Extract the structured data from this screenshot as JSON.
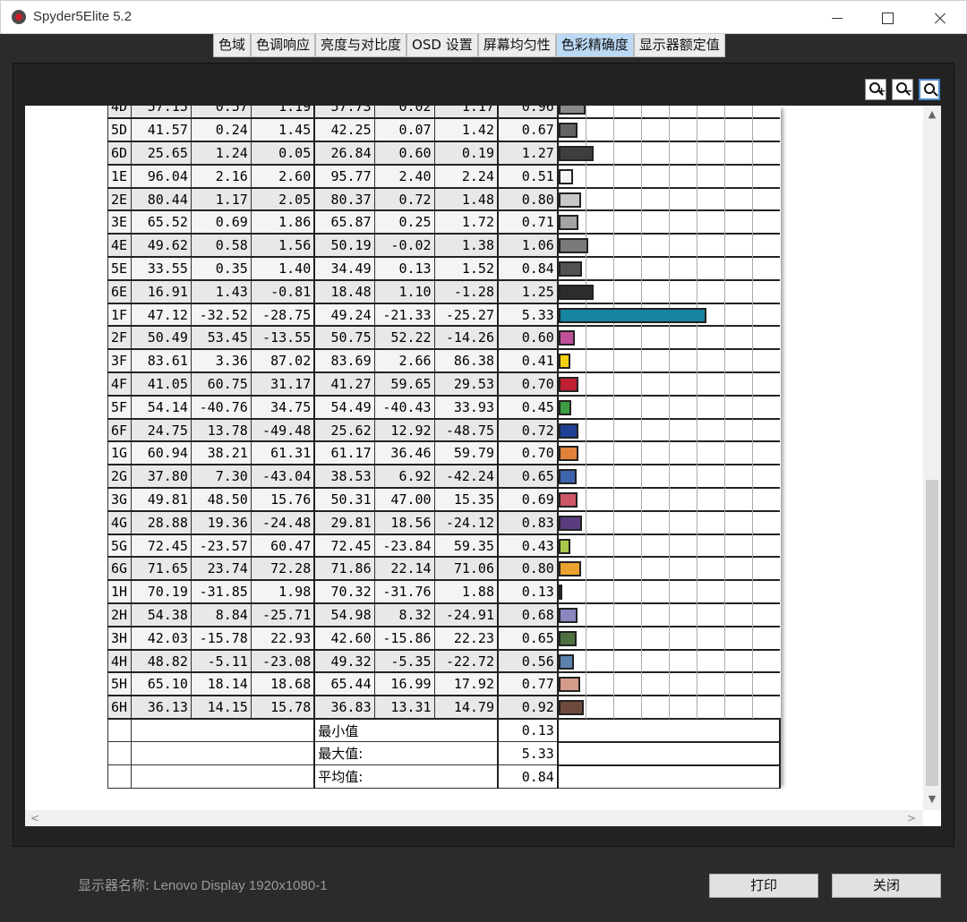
{
  "window": {
    "title": "Spyder5Elite 5.2"
  },
  "tabs": [
    {
      "label": "色域",
      "active": false
    },
    {
      "label": "色调响应",
      "active": false
    },
    {
      "label": "亮度与对比度",
      "active": false
    },
    {
      "label": "OSD 设置",
      "active": false
    },
    {
      "label": "屏幕均匀性",
      "active": false
    },
    {
      "label": "色彩精确度",
      "active": true
    },
    {
      "label": "显示器额定值",
      "active": false
    }
  ],
  "rows": [
    {
      "name": "4D",
      "v": [
        "57.15",
        "0.57",
        "1.19",
        "57.73",
        "0.02",
        "1.17"
      ],
      "de": "0.96",
      "color": "#8a8a8a"
    },
    {
      "name": "5D",
      "v": [
        "41.57",
        "0.24",
        "1.45",
        "42.25",
        "0.07",
        "1.42"
      ],
      "de": "0.67",
      "color": "#636363"
    },
    {
      "name": "6D",
      "v": [
        "25.65",
        "1.24",
        "0.05",
        "26.84",
        "0.60",
        "0.19"
      ],
      "de": "1.27",
      "color": "#3e3e3e"
    },
    {
      "name": "1E",
      "v": [
        "96.04",
        "2.16",
        "2.60",
        "95.77",
        "2.40",
        "2.24"
      ],
      "de": "0.51",
      "color": "#f5f5f5"
    },
    {
      "name": "2E",
      "v": [
        "80.44",
        "1.17",
        "2.05",
        "80.37",
        "0.72",
        "1.48"
      ],
      "de": "0.80",
      "color": "#c8c8c8"
    },
    {
      "name": "3E",
      "v": [
        "65.52",
        "0.69",
        "1.86",
        "65.87",
        "0.25",
        "1.72"
      ],
      "de": "0.71",
      "color": "#a3a3a3"
    },
    {
      "name": "4E",
      "v": [
        "49.62",
        "0.58",
        "1.56",
        "50.19",
        "-0.02",
        "1.38"
      ],
      "de": "1.06",
      "color": "#7a7a7a"
    },
    {
      "name": "5E",
      "v": [
        "33.55",
        "0.35",
        "1.40",
        "34.49",
        "0.13",
        "1.52"
      ],
      "de": "0.84",
      "color": "#525252"
    },
    {
      "name": "6E",
      "v": [
        "16.91",
        "1.43",
        "-0.81",
        "18.48",
        "1.10",
        "-1.28"
      ],
      "de": "1.25",
      "color": "#2c2c2c"
    },
    {
      "name": "1F",
      "v": [
        "47.12",
        "-32.52",
        "-28.75",
        "49.24",
        "-21.33",
        "-25.27"
      ],
      "de": "5.33",
      "color": "#1784a2"
    },
    {
      "name": "2F",
      "v": [
        "50.49",
        "53.45",
        "-13.55",
        "50.75",
        "52.22",
        "-14.26"
      ],
      "de": "0.60",
      "color": "#c0509a"
    },
    {
      "name": "3F",
      "v": [
        "83.61",
        "3.36",
        "87.02",
        "83.69",
        "2.66",
        "86.38"
      ],
      "de": "0.41",
      "color": "#f2d010"
    },
    {
      "name": "4F",
      "v": [
        "41.05",
        "60.75",
        "31.17",
        "41.27",
        "59.65",
        "29.53"
      ],
      "de": "0.70",
      "color": "#bf1f33"
    },
    {
      "name": "5F",
      "v": [
        "54.14",
        "-40.76",
        "34.75",
        "54.49",
        "-40.43",
        "33.93"
      ],
      "de": "0.45",
      "color": "#3d9e45"
    },
    {
      "name": "6F",
      "v": [
        "24.75",
        "13.78",
        "-49.48",
        "25.62",
        "12.92",
        "-48.75"
      ],
      "de": "0.72",
      "color": "#1f3f94"
    },
    {
      "name": "1G",
      "v": [
        "60.94",
        "38.21",
        "61.31",
        "61.17",
        "36.46",
        "59.79"
      ],
      "de": "0.70",
      "color": "#e0823a"
    },
    {
      "name": "2G",
      "v": [
        "37.80",
        "7.30",
        "-43.04",
        "38.53",
        "6.92",
        "-42.24"
      ],
      "de": "0.65",
      "color": "#3d64ad"
    },
    {
      "name": "3G",
      "v": [
        "49.81",
        "48.50",
        "15.76",
        "50.31",
        "47.00",
        "15.35"
      ],
      "de": "0.69",
      "color": "#cc5566"
    },
    {
      "name": "4G",
      "v": [
        "28.88",
        "19.36",
        "-24.48",
        "29.81",
        "18.56",
        "-24.12"
      ],
      "de": "0.83",
      "color": "#5a3d80"
    },
    {
      "name": "5G",
      "v": [
        "72.45",
        "-23.57",
        "60.47",
        "72.45",
        "-23.84",
        "59.35"
      ],
      "de": "0.43",
      "color": "#a8c84a"
    },
    {
      "name": "6G",
      "v": [
        "71.65",
        "23.74",
        "72.28",
        "71.86",
        "22.14",
        "71.06"
      ],
      "de": "0.80",
      "color": "#eba22e"
    },
    {
      "name": "1H",
      "v": [
        "70.19",
        "-31.85",
        "1.98",
        "70.32",
        "-31.76",
        "1.88"
      ],
      "de": "0.13",
      "color": "#34b79b"
    },
    {
      "name": "2H",
      "v": [
        "54.38",
        "8.84",
        "-25.71",
        "54.98",
        "8.32",
        "-24.91"
      ],
      "de": "0.68",
      "color": "#8a87c0"
    },
    {
      "name": "3H",
      "v": [
        "42.03",
        "-15.78",
        "22.93",
        "42.60",
        "-15.86",
        "22.23"
      ],
      "de": "0.65",
      "color": "#4e7040"
    },
    {
      "name": "4H",
      "v": [
        "48.82",
        "-5.11",
        "-23.08",
        "49.32",
        "-5.35",
        "-22.72"
      ],
      "de": "0.56",
      "color": "#5d82ad"
    },
    {
      "name": "5H",
      "v": [
        "65.10",
        "18.14",
        "18.68",
        "65.44",
        "16.99",
        "17.92"
      ],
      "de": "0.77",
      "color": "#d39c8a"
    },
    {
      "name": "6H",
      "v": [
        "36.13",
        "14.15",
        "15.78",
        "36.83",
        "13.31",
        "14.79"
      ],
      "de": "0.92",
      "color": "#6e4a3c"
    }
  ],
  "summary": {
    "min_label": "最小值",
    "min_value": "0.13",
    "max_label": "最大值:",
    "max_value": "5.33",
    "avg_label": "平均值:",
    "avg_value": "0.84"
  },
  "footer": {
    "display_label": "显示器名称:",
    "display_value": "Lenovo Display 1920x1080-1",
    "print_label": "打印",
    "close_label": "关闭"
  },
  "scrollbars": {
    "up_glyph": "▲",
    "down_glyph": "▼",
    "left_glyph": "<",
    "right_glyph": ">"
  }
}
